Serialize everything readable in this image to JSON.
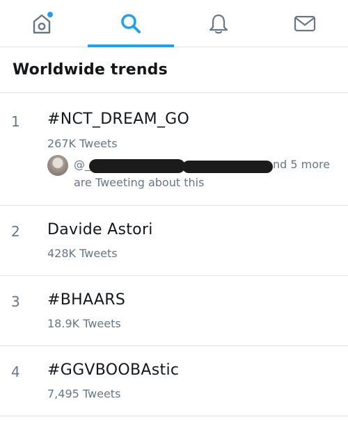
{
  "tabs": [
    {
      "name": "home",
      "icon": "home-icon",
      "has_dot": true
    },
    {
      "name": "search",
      "icon": "search-icon",
      "active": true
    },
    {
      "name": "notifications",
      "icon": "bell-icon"
    },
    {
      "name": "messages",
      "icon": "mail-icon"
    }
  ],
  "colors": {
    "accent": "#1da1f2",
    "secondary_text": "#657786",
    "divider": "#dfe3e6"
  },
  "section": {
    "title": "Worldwide trends"
  },
  "trends": [
    {
      "rank": "1",
      "name": "#NCT_DREAM_GO",
      "count": "267K Tweets",
      "handle_prefix": "@_",
      "and_more": "nd 5 more",
      "tweeting_text": "are Tweeting about this"
    },
    {
      "rank": "2",
      "name": "Davide Astori",
      "count": "428K Tweets"
    },
    {
      "rank": "3",
      "name": "#BHAARS",
      "count": "18.9K Tweets"
    },
    {
      "rank": "4",
      "name": "#GGVBOOBAstic",
      "count": "7,495 Tweets"
    }
  ]
}
